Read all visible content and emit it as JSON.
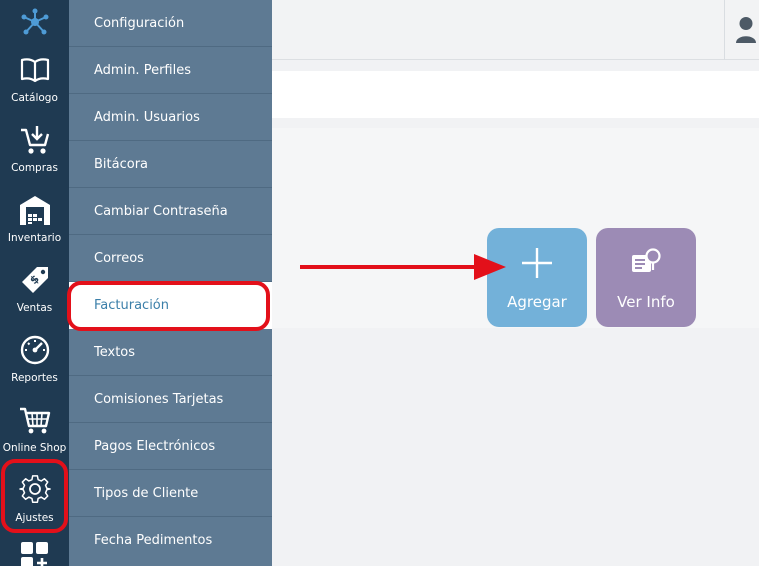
{
  "rail": {
    "items": [
      {
        "label": "Catálogo",
        "icon": "book-icon"
      },
      {
        "label": "Compras",
        "icon": "cart-download-icon"
      },
      {
        "label": "Inventario",
        "icon": "warehouse-icon"
      },
      {
        "label": "Ventas",
        "icon": "price-tag-icon"
      },
      {
        "label": "Reportes",
        "icon": "gauge-icon"
      },
      {
        "label": "Online Shop",
        "icon": "shopping-cart-icon"
      },
      {
        "label": "Ajustes",
        "icon": "gear-icon"
      }
    ]
  },
  "submenu": {
    "items": [
      {
        "label": "Configuración"
      },
      {
        "label": "Admin. Perfiles"
      },
      {
        "label": "Admin. Usuarios"
      },
      {
        "label": "Bitácora"
      },
      {
        "label": "Cambiar Contraseña"
      },
      {
        "label": "Correos"
      },
      {
        "label": "Facturación"
      },
      {
        "label": "Textos"
      },
      {
        "label": "Comisiones Tarjetas"
      },
      {
        "label": "Pagos Electrónicos"
      },
      {
        "label": "Tipos de Cliente"
      },
      {
        "label": "Fecha Pedimentos"
      }
    ],
    "active_index": 6
  },
  "actions": {
    "add_label": "Agregar",
    "info_label": "Ver Info"
  },
  "colors": {
    "rail_bg": "#1f3a52",
    "submenu_bg": "#5e7a93",
    "active_text": "#3b7fa9",
    "add_tile": "#73b1d9",
    "info_tile": "#9c8bb5",
    "highlight": "#e3101a"
  }
}
